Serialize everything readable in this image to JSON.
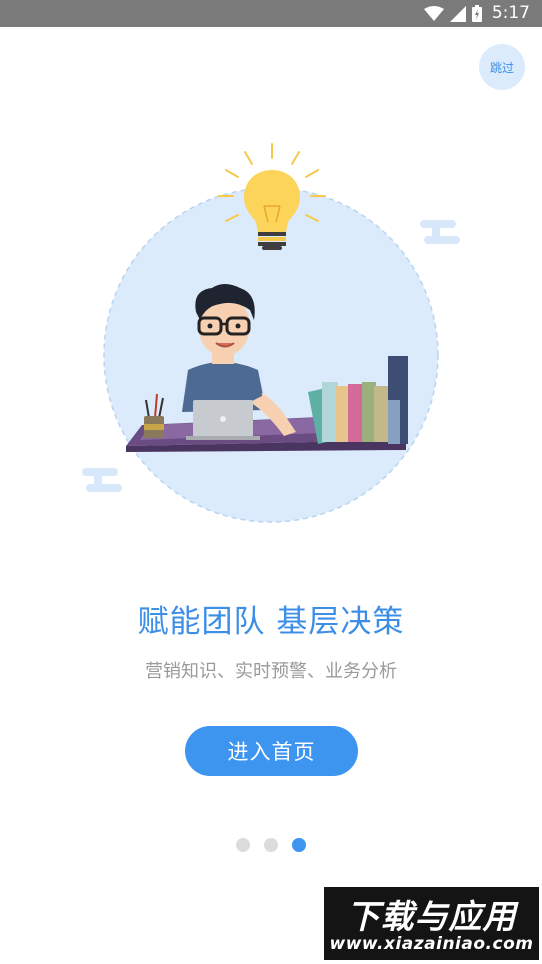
{
  "status_bar": {
    "time": "5:17",
    "icons": [
      "wifi-icon",
      "signal-icon",
      "battery-icon"
    ]
  },
  "skip": {
    "label": "跳过"
  },
  "illustration": {
    "name": "person-at-desk-with-lightbulb-illustration"
  },
  "headline": "赋能团队 基层决策",
  "subtitle": "营销知识、实时预警、业务分析",
  "enter_button": {
    "label": "进入首页"
  },
  "pagination": {
    "total": 3,
    "active_index": 2
  },
  "watermark": {
    "title": "下载与应用",
    "url": "www.xiazainiao.com"
  },
  "colors": {
    "accent": "#3d95f0",
    "headline": "#3d8ee6",
    "circle_bg": "#dcebfb"
  }
}
